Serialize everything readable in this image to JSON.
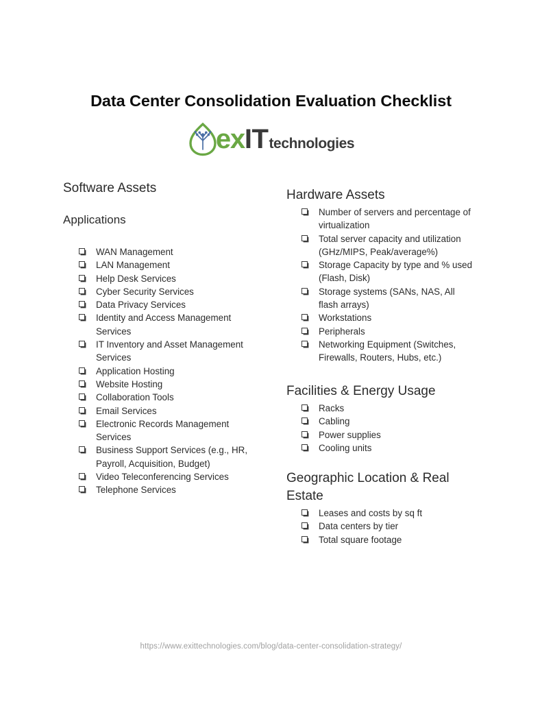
{
  "document": {
    "title": "Data Center Consolidation Evaluation Checklist"
  },
  "logo": {
    "mark_name": "leaf-circuit-icon",
    "leaf_color": "#6aa844",
    "circuit_color": "#4a6fa5",
    "text_ex": "ex",
    "text_it": "IT",
    "text_technologies": "technologies"
  },
  "left_column": {
    "heading": "Software Assets",
    "subheading": "Applications",
    "items": [
      "WAN Management",
      "LAN Management",
      "Help Desk Services",
      "Cyber Security Services",
      "Data Privacy Services",
      "Identity and Access Management Services",
      "IT Inventory and Asset Management Services",
      "Application Hosting",
      "Website Hosting",
      "Collaboration Tools",
      "Email Services",
      "Electronic Records Management Services",
      "Business Support Services (e.g., HR, Payroll, Acquisition, Budget)",
      "Video Teleconferencing Services",
      "Telephone Services"
    ]
  },
  "right_column": {
    "sections": [
      {
        "heading": "Hardware Assets",
        "items": [
          "Number of servers and percentage of virtualization",
          "Total server capacity and utilization (GHz/MIPS, Peak/average%)",
          "Storage Capacity by type and % used (Flash, Disk)",
          "Storage systems (SANs, NAS, All flash arrays)",
          "Workstations",
          "Peripherals",
          "Networking Equipment (Switches, Firewalls, Routers, Hubs, etc.)"
        ]
      },
      {
        "heading": "Facilities & Energy Usage",
        "items": [
          "Racks",
          "Cabling",
          "Power supplies",
          "Cooling units"
        ]
      },
      {
        "heading": "Geographic Location & Real Estate",
        "items": [
          "Leases and costs by sq ft",
          "Data centers by tier",
          "Total square footage"
        ]
      }
    ]
  },
  "footer": {
    "url": "https://www.exittechnologies.com/blog/data-center-consolidation-strategy/"
  }
}
